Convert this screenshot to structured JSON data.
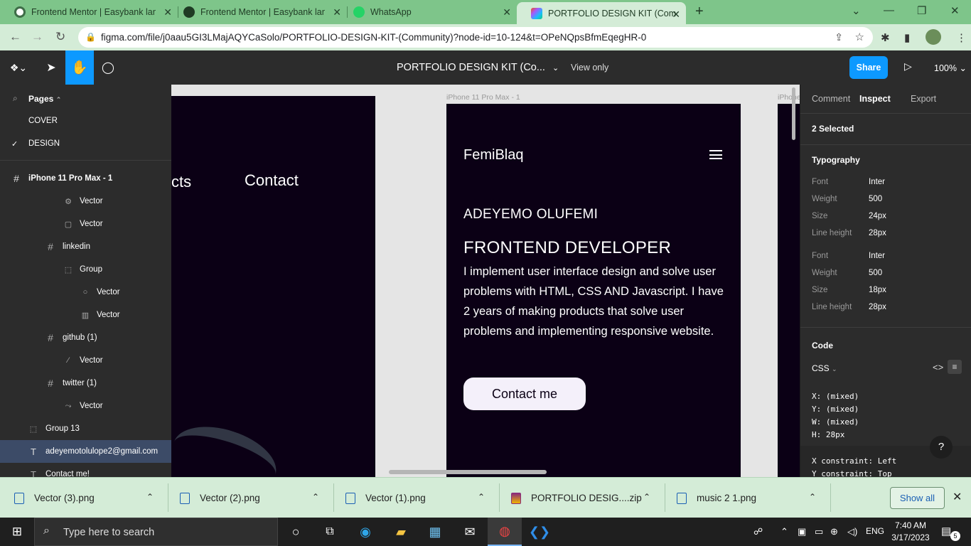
{
  "browser": {
    "tabs": [
      {
        "title": "Frontend Mentor | Easybank land",
        "icon": "frontend-mentor-icon"
      },
      {
        "title": "Frontend Mentor | Easybank land",
        "icon": "globe-icon"
      },
      {
        "title": "WhatsApp",
        "icon": "whatsapp-icon"
      },
      {
        "title": "PORTFOLIO DESIGN KIT (Commu",
        "icon": "figma-icon",
        "active": true
      }
    ],
    "new_tab": "+",
    "url": "figma.com/file/j0aau5GI3LMajAQYCaSolo/PORTFOLIO-DESIGN-KIT-(Community)?node-id=10-124&t=OPeNQpsBfmEqegHR-0"
  },
  "figma": {
    "doc_title": "PORTFOLIO DESIGN KIT (Co...",
    "view_only": "View only",
    "share": "Share",
    "zoom": "100%",
    "pages_label": "Pages",
    "pages": [
      "COVER",
      "DESIGN"
    ],
    "layers": [
      {
        "name": "iPhone 11 Pro Max - 1",
        "icon": "frame-icon",
        "bold": true
      },
      {
        "name": "Vector",
        "icon": "vector-icon"
      },
      {
        "name": "Vector",
        "icon": "vector-icon"
      },
      {
        "name": "linkedin",
        "icon": "frame-icon"
      },
      {
        "name": "Group",
        "icon": "group-icon"
      },
      {
        "name": "Vector",
        "icon": "vector-icon"
      },
      {
        "name": "Vector",
        "icon": "vector-icon"
      },
      {
        "name": "github (1)",
        "icon": "frame-icon"
      },
      {
        "name": "Vector",
        "icon": "vector-icon"
      },
      {
        "name": "twitter (1)",
        "icon": "frame-icon"
      },
      {
        "name": "Vector",
        "icon": "vector-icon"
      },
      {
        "name": "Group 13",
        "icon": "group-icon"
      },
      {
        "name": "adeyemotolulope2@gmail.com",
        "icon": "text-icon",
        "selected": true
      },
      {
        "name": "Contact me!",
        "icon": "text-icon"
      }
    ]
  },
  "canvas": {
    "left_frame_text_partial": "cts",
    "left_frame_contact": "Contact",
    "frame_label": "iPhone 11 Pro Max - 1",
    "frame_label_right": "iPhone",
    "brand": "FemiBlaq",
    "name": "ADEYEMO OLUFEMI",
    "role": "FRONTEND DEVELOPER",
    "bio": "I implement user interface design and solve user problems with HTML, CSS AND Javascript. I have 2 years of making products that solve user problems and implementing responsive website.",
    "cta": "Contact me"
  },
  "inspect": {
    "tabs": [
      "Comment",
      "Inspect",
      "Export"
    ],
    "selected": "2 Selected",
    "typography_label": "Typography",
    "typo": [
      {
        "font": "Inter",
        "weight": "500",
        "size": "24px",
        "line_height": "28px"
      },
      {
        "font": "Inter",
        "weight": "500",
        "size": "18px",
        "line_height": "28px"
      }
    ],
    "labels": {
      "font": "Font",
      "weight": "Weight",
      "size": "Size",
      "line_height": "Line height"
    },
    "code_label": "Code",
    "code_lang": "CSS",
    "code_lines": [
      "X: (mixed)",
      "Y: (mixed)",
      "W: (mixed)",
      "H: 28px",
      "X constraint: Left",
      "Y constraint: Top"
    ],
    "help": "?"
  },
  "downloads": {
    "items": [
      "Vector (3).png",
      "Vector (2).png",
      "Vector (1).png",
      "PORTFOLIO DESIG....zip",
      "music 2 1.png"
    ],
    "show_all": "Show all"
  },
  "taskbar": {
    "search_placeholder": "Type here to search",
    "lang": "ENG",
    "time": "7:40 AM",
    "date": "3/17/2023",
    "notif_count": "5"
  }
}
